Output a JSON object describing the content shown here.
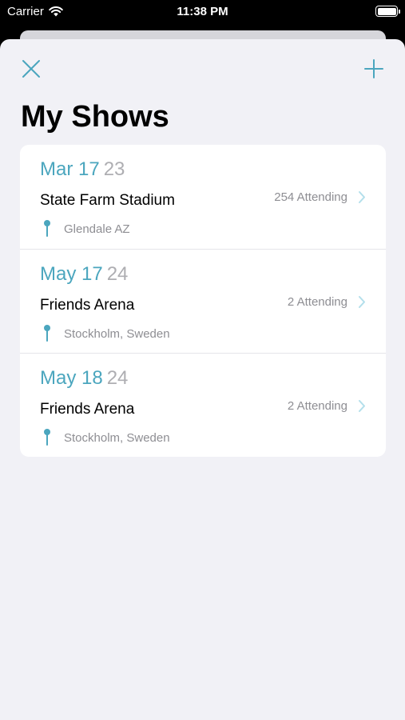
{
  "status_bar": {
    "carrier": "Carrier",
    "time": "11:38 PM"
  },
  "nav": {
    "close_icon": "close-icon",
    "add_icon": "plus-icon"
  },
  "title": "My Shows",
  "colors": {
    "accent": "#4ba6be",
    "year": "#aeaeb2",
    "secondary": "#8e8e93",
    "background": "#f1f1f6"
  },
  "shows": [
    {
      "date": "Mar 17",
      "year": "23",
      "venue": "State Farm Stadium",
      "attending": "254 Attending",
      "location": "Glendale AZ"
    },
    {
      "date": "May 17",
      "year": "24",
      "venue": "Friends Arena",
      "attending": "2 Attending",
      "location": "Stockholm, Sweden"
    },
    {
      "date": "May 18",
      "year": "24",
      "venue": "Friends Arena",
      "attending": "2 Attending",
      "location": "Stockholm, Sweden"
    }
  ]
}
